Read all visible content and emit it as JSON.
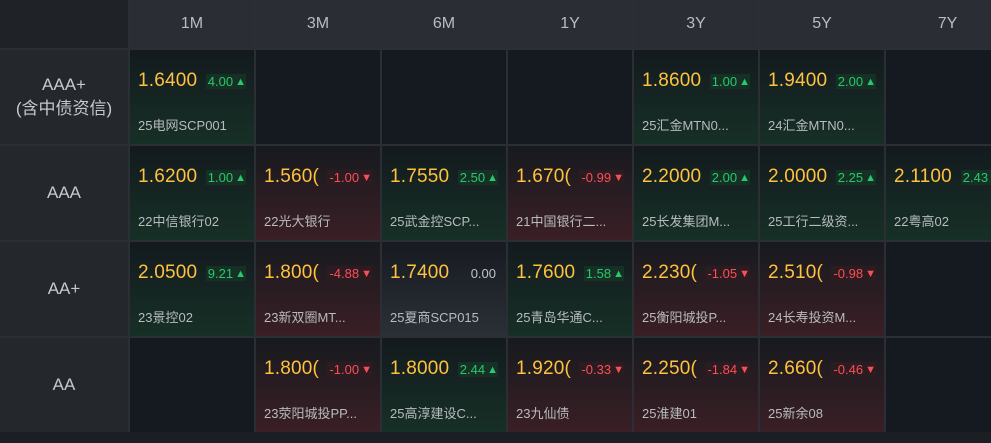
{
  "columns": [
    "1M",
    "3M",
    "6M",
    "1Y",
    "3Y",
    "5Y",
    "7Y"
  ],
  "rows": [
    {
      "label_lines": [
        "AAA+",
        "(含中债资信)"
      ],
      "cells": [
        {
          "yield": "1.6400",
          "change": "4.00",
          "dir": "up",
          "bond": "25电网SCP001"
        },
        null,
        null,
        null,
        {
          "yield": "1.8600",
          "change": "1.00",
          "dir": "up",
          "bond": "25汇金MTN0..."
        },
        {
          "yield": "1.9400",
          "change": "2.00",
          "dir": "up",
          "bond": "24汇金MTN0..."
        },
        null
      ]
    },
    {
      "label_lines": [
        "AAA"
      ],
      "cells": [
        {
          "yield": "1.6200",
          "change": "1.00",
          "dir": "up",
          "bond": "22中信银行02"
        },
        {
          "yield": "1.560(",
          "change": "-1.00",
          "dir": "down",
          "bond": "22光大银行"
        },
        {
          "yield": "1.7550",
          "change": "2.50",
          "dir": "up",
          "bond": "25武金控SCP..."
        },
        {
          "yield": "1.670(",
          "change": "-0.99",
          "dir": "down",
          "bond": "21中国银行二..."
        },
        {
          "yield": "2.2000",
          "change": "2.00",
          "dir": "up",
          "bond": "25长发集团M..."
        },
        {
          "yield": "2.0000",
          "change": "2.25",
          "dir": "up",
          "bond": "25工行二级资..."
        },
        {
          "yield": "2.1100",
          "change": "2.43",
          "dir": "up",
          "bond": "22粤高02"
        }
      ]
    },
    {
      "label_lines": [
        "AA+"
      ],
      "cells": [
        {
          "yield": "2.0500",
          "change": "9.21",
          "dir": "up",
          "bond": "23景控02"
        },
        {
          "yield": "1.800(",
          "change": "-4.88",
          "dir": "down",
          "bond": "23新双圈MT..."
        },
        {
          "yield": "1.7400",
          "change": "0.00",
          "dir": "flat",
          "bond": "25夏商SCP015"
        },
        {
          "yield": "1.7600",
          "change": "1.58",
          "dir": "up",
          "bond": "25青岛华通C..."
        },
        {
          "yield": "2.230(",
          "change": "-1.05",
          "dir": "down",
          "bond": "25衡阳城投P..."
        },
        {
          "yield": "2.510(",
          "change": "-0.98",
          "dir": "down",
          "bond": "24长寿投资M..."
        },
        null
      ]
    },
    {
      "label_lines": [
        "AA"
      ],
      "cells": [
        null,
        {
          "yield": "1.800(",
          "change": "-1.00",
          "dir": "down",
          "bond": "23荥阳城投PP..."
        },
        {
          "yield": "1.8000",
          "change": "2.44",
          "dir": "up",
          "bond": "25高淳建设C..."
        },
        {
          "yield": "1.920(",
          "change": "-0.33",
          "dir": "down",
          "bond": "23九仙债"
        },
        {
          "yield": "2.250(",
          "change": "-1.84",
          "dir": "down",
          "bond": "25淮建01"
        },
        {
          "yield": "2.660(",
          "change": "-0.46",
          "dir": "down",
          "bond": "25新余08"
        },
        null
      ]
    }
  ],
  "icons": {
    "up": "triangle-up-icon",
    "down": "triangle-down-icon"
  },
  "colors": {
    "yield": "#ffc23e",
    "up": "#27c96a",
    "down": "#ff4d55",
    "flat": "#c0c3c7"
  }
}
